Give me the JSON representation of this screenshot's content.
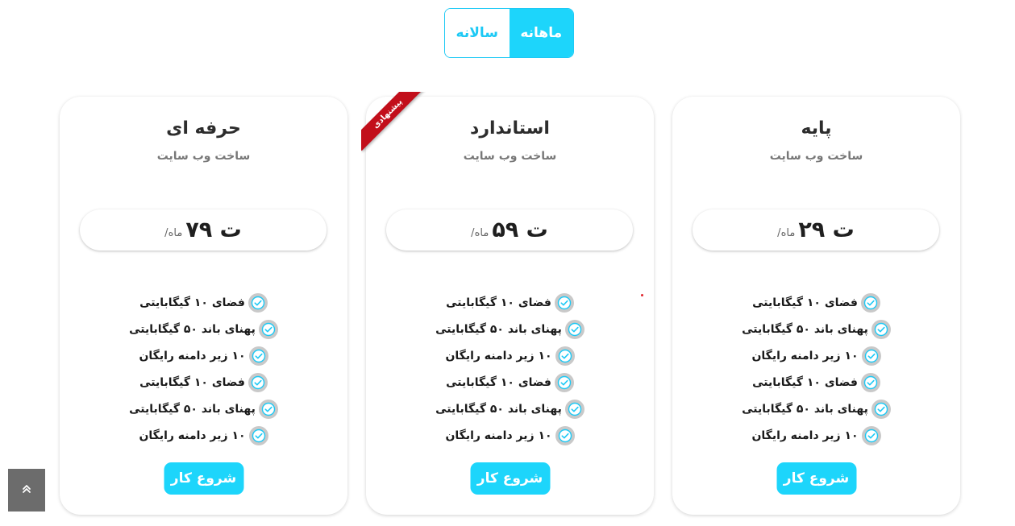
{
  "billing_toggle": {
    "monthly_label": "ماهانه",
    "yearly_label": "سالانه",
    "selected": "monthly",
    "accent_color": "#1dd5fb"
  },
  "plans": [
    {
      "title": "حرفه ای",
      "subtitle": "ساخت وب سایت",
      "price": "۷۹ ت",
      "per": "/ماه",
      "features": [
        "فضای ۱۰ گیگابایتی",
        "پهنای باند ۵۰ گیگابایتی",
        "۱۰ زیر دامنه رایگان",
        "فضای ۱۰ گیگابایتی",
        "پهنای باند ۵۰ گیگابایتی",
        "۱۰ زیر دامنه رایگان"
      ],
      "button_label": "شروع کار"
    },
    {
      "title": "استاندارد",
      "subtitle": "ساخت وب سایت",
      "price": "۵۹ ت",
      "per": "/ماه",
      "ribbon": "پیشنهادی",
      "features": [
        "فضای ۱۰ گیگابایتی",
        "پهنای باند ۵۰ گیگابایتی",
        "۱۰ زیر دامنه رایگان",
        "فضای ۱۰ گیگابایتی",
        "پهنای باند ۵۰ گیگابایتی",
        "۱۰ زیر دامنه رایگان"
      ],
      "button_label": "شروع کار"
    },
    {
      "title": "پایه",
      "subtitle": "ساخت وب سایت",
      "price": "۲۹ ت",
      "per": "/ماه",
      "features": [
        "فضای ۱۰ گیگابایتی",
        "پهنای باند ۵۰ گیگابایتی",
        "۱۰ زیر دامنه رایگان",
        "فضای ۱۰ گیگابایتی",
        "پهنای باند ۵۰ گیگابایتی",
        "۱۰ زیر دامنه رایگان"
      ],
      "button_label": "شروع کار"
    }
  ],
  "icons": {
    "feature_icon": "check-circle-icon",
    "scroll_top_icon": "double-chevron-up-icon"
  },
  "colors": {
    "accent": "#1dd5fb",
    "ribbon": "#c20f1b",
    "check_bg": "#c9c9c9",
    "scroll_top_bg": "#6c6c6c"
  }
}
